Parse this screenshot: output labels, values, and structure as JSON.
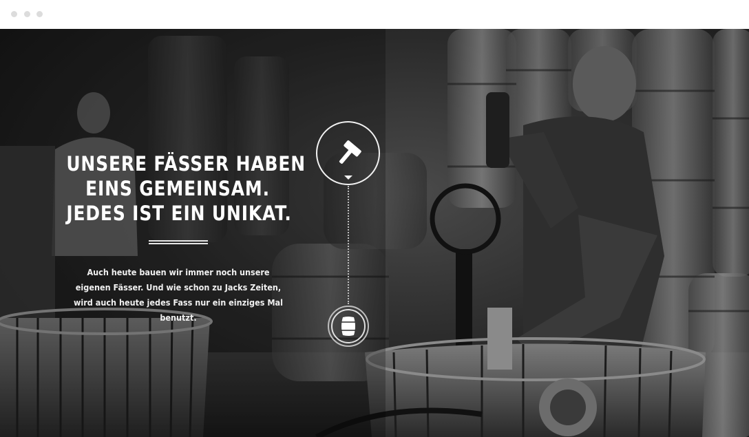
{
  "window": {
    "controls": [
      "close",
      "minimize",
      "maximize"
    ]
  },
  "hero": {
    "headline_lines": [
      "UNSERE FÄSSER HABEN",
      "EINS GEMEINSAM.",
      "JEDES IST EIN UNIKAT."
    ],
    "body_text": "Auch heute bauen wir immer noch unsere eigenen Fässer. Und wie schon zu Jacks Zeiten, wird auch heute jedes Fass nur ein einziges Mal benutzt.",
    "icons": {
      "top": "hammer-icon",
      "bottom": "barrel-icon"
    },
    "colors": {
      "text": "#ffffff",
      "background": "#2a2a2a"
    }
  }
}
